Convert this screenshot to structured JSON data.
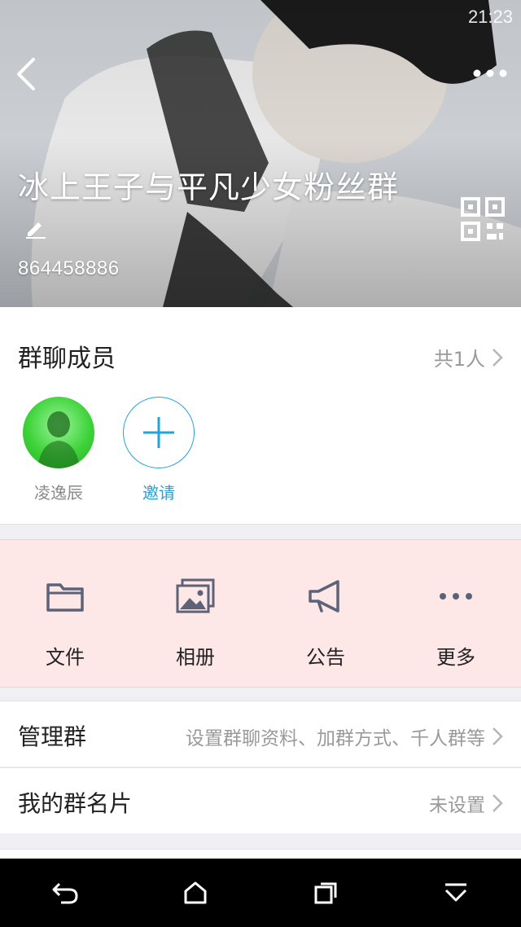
{
  "status": {
    "time": "21:23"
  },
  "group": {
    "title": "冰上王子与平凡少女粉丝群",
    "id": "864458886"
  },
  "members": {
    "label": "群聊成员",
    "count": "共1人",
    "list": [
      {
        "name": "凌逸辰"
      }
    ],
    "invite_label": "邀请"
  },
  "actions": [
    {
      "label": "文件",
      "icon": "folder-icon"
    },
    {
      "label": "相册",
      "icon": "album-icon"
    },
    {
      "label": "公告",
      "icon": "megaphone-icon"
    },
    {
      "label": "更多",
      "icon": "more-dots-icon"
    }
  ],
  "settings": {
    "manage": {
      "label": "管理群",
      "value": "设置群聊资料、加群方式、千人群等"
    },
    "card": {
      "label": "我的群名片",
      "value": "未设置"
    }
  },
  "colors": {
    "accent": "#26a3d6",
    "action_bg": "#fde7e7",
    "avatar_green": "#3fd33b"
  }
}
